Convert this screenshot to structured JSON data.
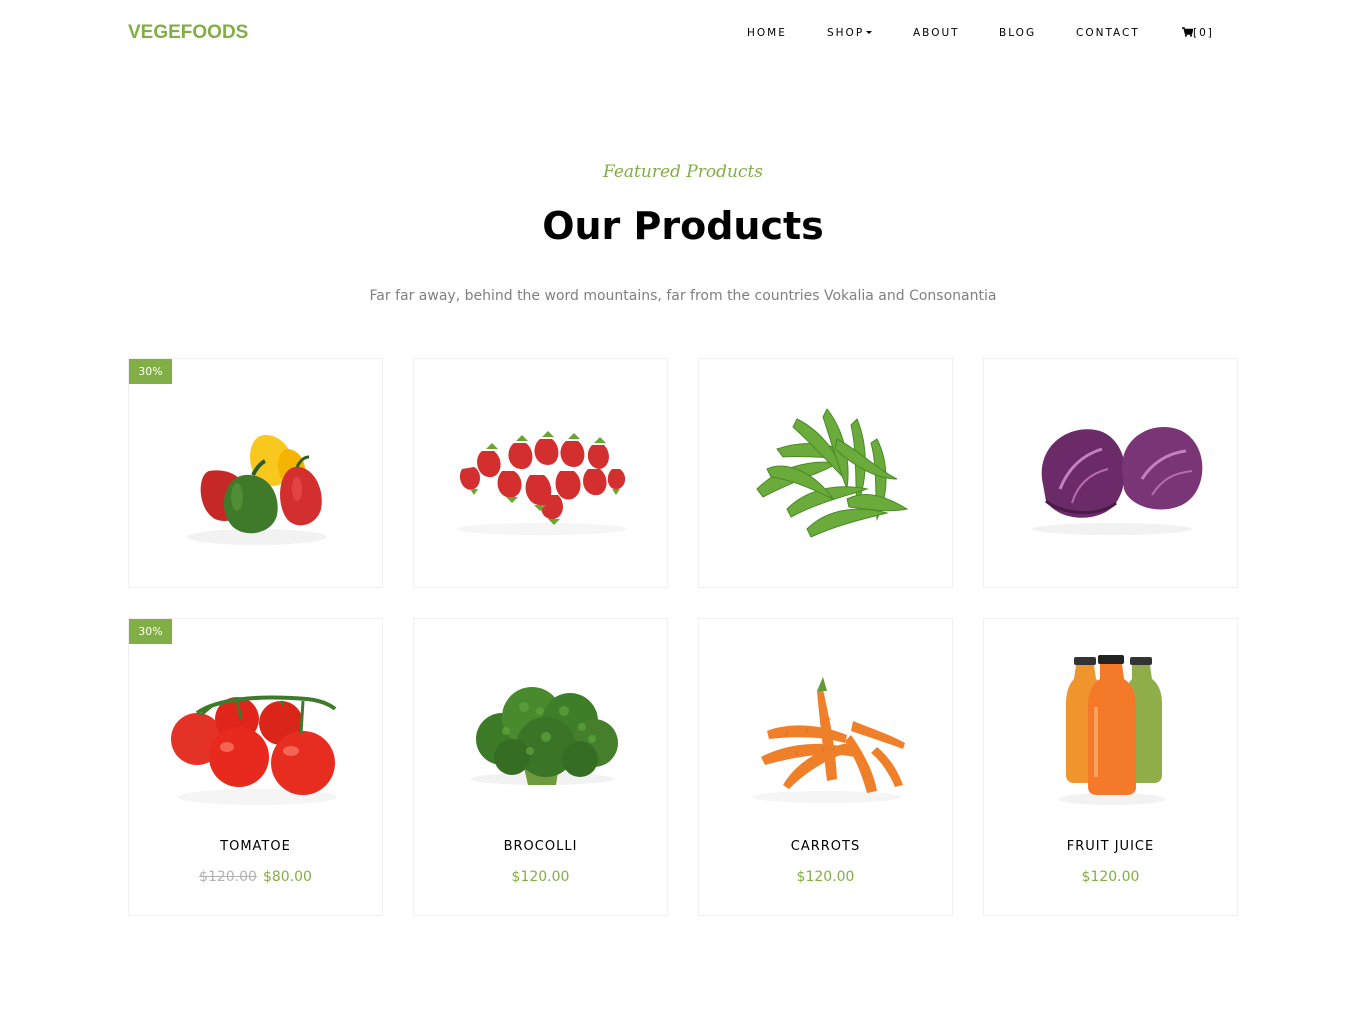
{
  "brand": {
    "name": "VEGEFOODS",
    "color": "#82ae46"
  },
  "nav": {
    "home": "HOME",
    "shop": "SHOP",
    "about": "ABOUT",
    "blog": "BLOG",
    "contact": "CONTACT",
    "cart_count": "[0]",
    "cart_icon": "cart-icon"
  },
  "section": {
    "subheading": "Featured Products",
    "heading": "Our Products",
    "lead": "Far far away, behind the word mountains, far from the countries Vokalia and Consonantia"
  },
  "products": [
    {
      "image": "bell-pepper",
      "badge": "30%"
    },
    {
      "image": "strawberry"
    },
    {
      "image": "green-beans"
    },
    {
      "image": "purple-cabbage"
    },
    {
      "image": "tomato",
      "badge": "30%",
      "name": "TOMATOE",
      "old_price": "$120.00",
      "price": "$80.00"
    },
    {
      "image": "broccoli",
      "name": "BROCOLLI",
      "price": "$120.00"
    },
    {
      "image": "carrots",
      "name": "CARROTS",
      "price": "$120.00"
    },
    {
      "image": "fruit-juice",
      "name": "FRUIT JUICE",
      "price": "$120.00"
    }
  ]
}
